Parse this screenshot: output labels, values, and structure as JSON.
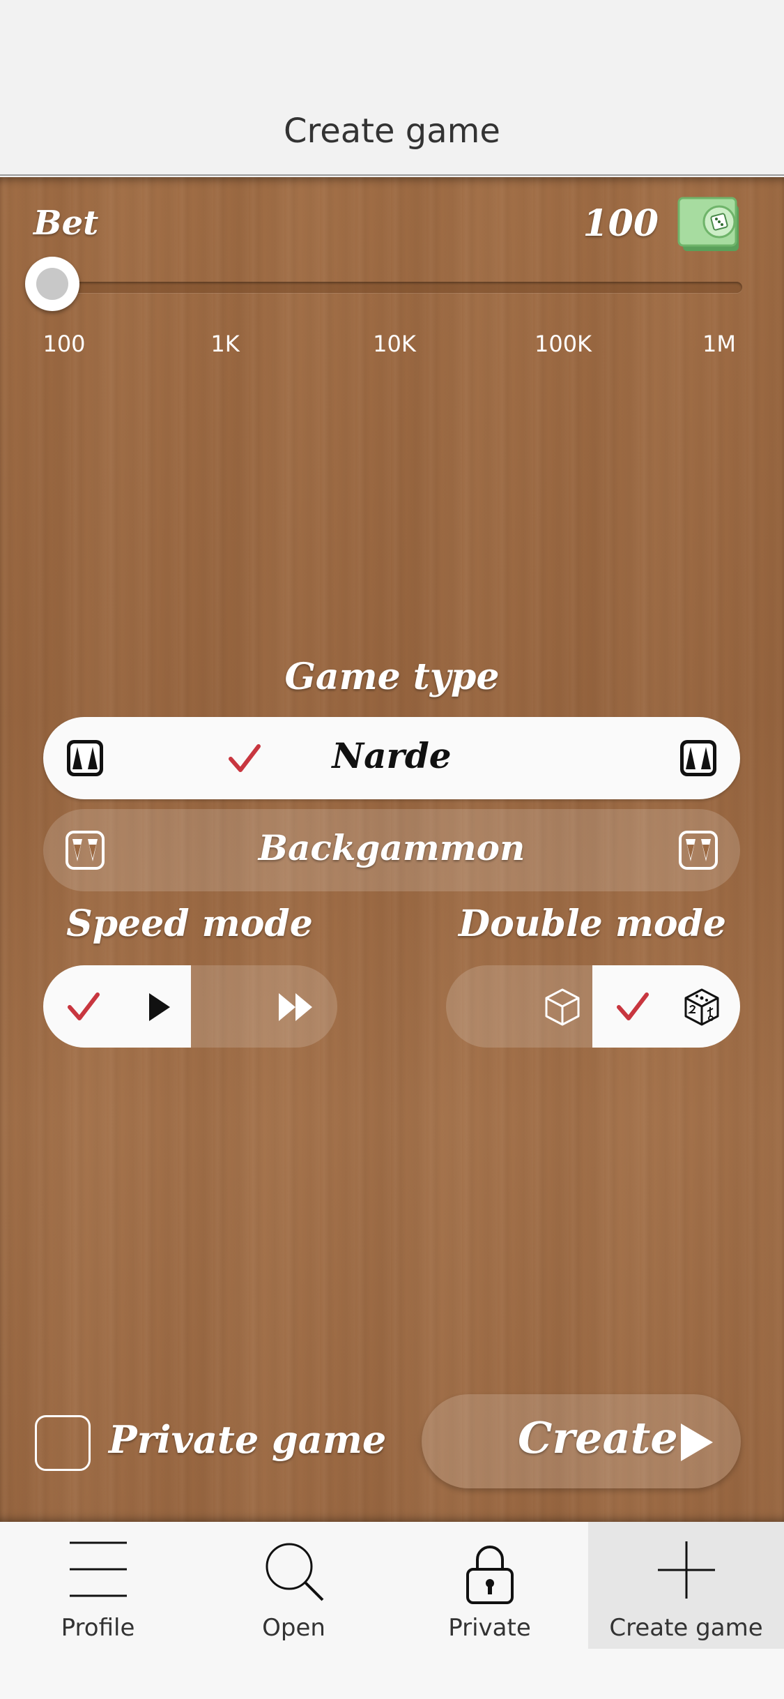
{
  "header": {
    "title": "Create game"
  },
  "bet": {
    "label": "Bet",
    "value": "100",
    "slider_position": 0,
    "ticks": [
      "100",
      "1K",
      "10K",
      "100K",
      "1M"
    ]
  },
  "game_type": {
    "title": "Game type",
    "options": [
      {
        "label": "Narde",
        "selected": true
      },
      {
        "label": "Backgammon",
        "selected": false
      }
    ]
  },
  "speed_mode": {
    "title": "Speed mode",
    "options": [
      {
        "name": "normal",
        "icon": "play-icon",
        "selected": true
      },
      {
        "name": "fast",
        "icon": "fast-forward-icon",
        "selected": false
      }
    ]
  },
  "double_mode": {
    "title": "Double mode",
    "options": [
      {
        "name": "off",
        "icon": "cube-icon",
        "selected": false
      },
      {
        "name": "on",
        "icon": "doubling-cube-icon",
        "selected": true
      }
    ]
  },
  "private_game": {
    "label": "Private game",
    "checked": false
  },
  "create_button": {
    "label": "Create"
  },
  "tabs": [
    {
      "label": "Profile",
      "icon": "menu-icon",
      "active": false
    },
    {
      "label": "Open",
      "icon": "search-icon",
      "active": false
    },
    {
      "label": "Private",
      "icon": "lock-icon",
      "active": false
    },
    {
      "label": "Create game",
      "icon": "plus-icon",
      "active": true
    }
  ],
  "colors": {
    "wood": "#9c6a43",
    "check_red": "#c8363f",
    "money_green": "#8fcf8a"
  }
}
